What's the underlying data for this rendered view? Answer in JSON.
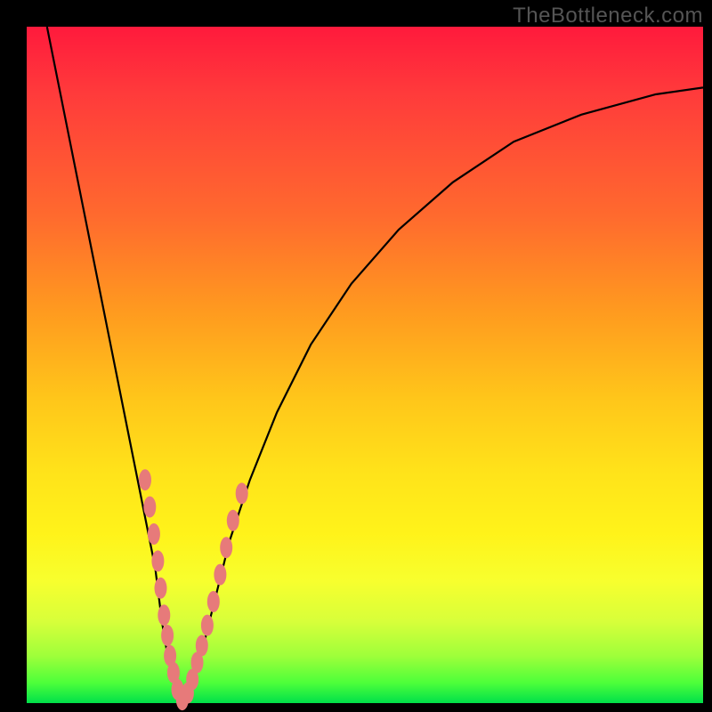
{
  "watermark": "TheBottleneck.com",
  "colors": {
    "frame": "#000000",
    "curve": "#000000",
    "dot_fill": "#e77a7a",
    "dot_stroke": "#a44747"
  },
  "chart_data": {
    "type": "line",
    "title": "",
    "xlabel": "",
    "ylabel": "",
    "xlim": [
      0,
      100
    ],
    "ylim": [
      0,
      100
    ],
    "grid": false,
    "legend": false,
    "series": [
      {
        "name": "curve",
        "x": [
          3,
          5,
          7,
          9,
          11,
          13,
          15,
          17,
          19,
          20,
          21,
          22,
          23,
          24,
          26,
          28,
          30,
          33,
          37,
          42,
          48,
          55,
          63,
          72,
          82,
          93,
          100
        ],
        "y": [
          100,
          90,
          80,
          70,
          60,
          50,
          40,
          30,
          20,
          12,
          6,
          2,
          0,
          2,
          8,
          16,
          24,
          33,
          43,
          53,
          62,
          70,
          77,
          83,
          87,
          90,
          91
        ]
      }
    ],
    "annotations": {
      "dots": [
        {
          "x": 17.5,
          "y": 33
        },
        {
          "x": 18.2,
          "y": 29
        },
        {
          "x": 18.8,
          "y": 25
        },
        {
          "x": 19.4,
          "y": 21
        },
        {
          "x": 19.8,
          "y": 17
        },
        {
          "x": 20.3,
          "y": 13
        },
        {
          "x": 20.8,
          "y": 10
        },
        {
          "x": 21.2,
          "y": 7
        },
        {
          "x": 21.7,
          "y": 4.5
        },
        {
          "x": 22.3,
          "y": 2
        },
        {
          "x": 23.0,
          "y": 0.5
        },
        {
          "x": 23.8,
          "y": 1.5
        },
        {
          "x": 24.5,
          "y": 3.5
        },
        {
          "x": 25.2,
          "y": 6
        },
        {
          "x": 25.9,
          "y": 8.5
        },
        {
          "x": 26.7,
          "y": 11.5
        },
        {
          "x": 27.6,
          "y": 15
        },
        {
          "x": 28.6,
          "y": 19
        },
        {
          "x": 29.5,
          "y": 23
        },
        {
          "x": 30.5,
          "y": 27
        },
        {
          "x": 31.8,
          "y": 31
        }
      ]
    }
  }
}
